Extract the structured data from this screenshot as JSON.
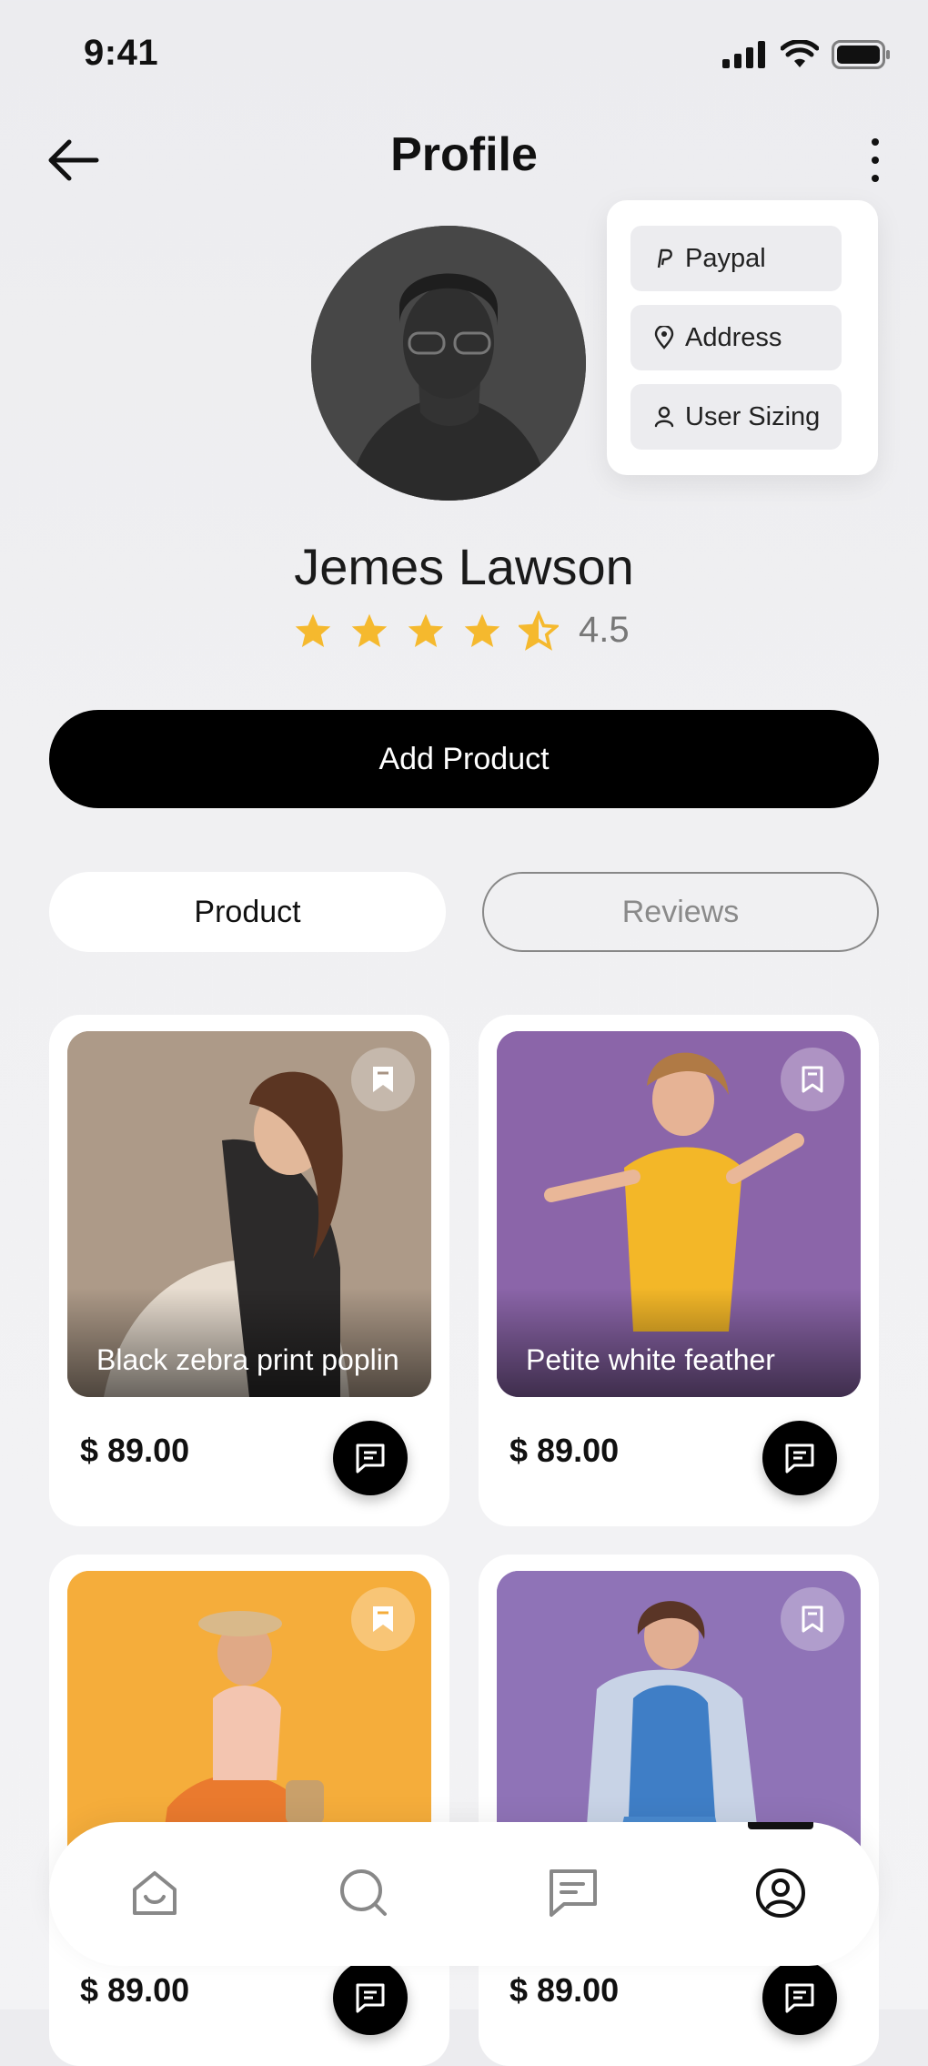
{
  "status_bar": {
    "time": "9:41"
  },
  "header": {
    "title": "Profile"
  },
  "menu": {
    "items": [
      {
        "label": "Paypal",
        "icon": "paypal-icon"
      },
      {
        "label": "Address",
        "icon": "location-pin-icon"
      },
      {
        "label": "User Sizing",
        "icon": "user-icon"
      }
    ]
  },
  "profile": {
    "name": "Jemes Lawson",
    "rating": "4.5",
    "rating_value": 4.5,
    "rating_max": 5
  },
  "actions": {
    "add_product": "Add Product"
  },
  "tabs": [
    {
      "label": "Product",
      "active": true
    },
    {
      "label": "Reviews",
      "active": false
    }
  ],
  "products": [
    {
      "title": "Black zebra print poplin",
      "price": "$ 89.00",
      "bookmarked": true,
      "image_color": "#a89484"
    },
    {
      "title": "Petite white feather",
      "price": "$ 89.00",
      "bookmarked": false,
      "image_color": "#8a63a8"
    },
    {
      "title": "",
      "price": "$ 89.00",
      "bookmarked": true,
      "image_color": "#f4ac3a"
    },
    {
      "title": "",
      "price": "$ 89.00",
      "bookmarked": false,
      "image_color": "#8e72b6"
    }
  ],
  "bottom_nav": [
    {
      "icon": "home-icon",
      "active": false
    },
    {
      "icon": "search-icon",
      "active": false
    },
    {
      "icon": "chat-icon",
      "active": false
    },
    {
      "icon": "profile-icon",
      "active": true
    }
  ],
  "colors": {
    "accent": "#000000",
    "star": "#f5b92e",
    "background": "#efeff1"
  }
}
